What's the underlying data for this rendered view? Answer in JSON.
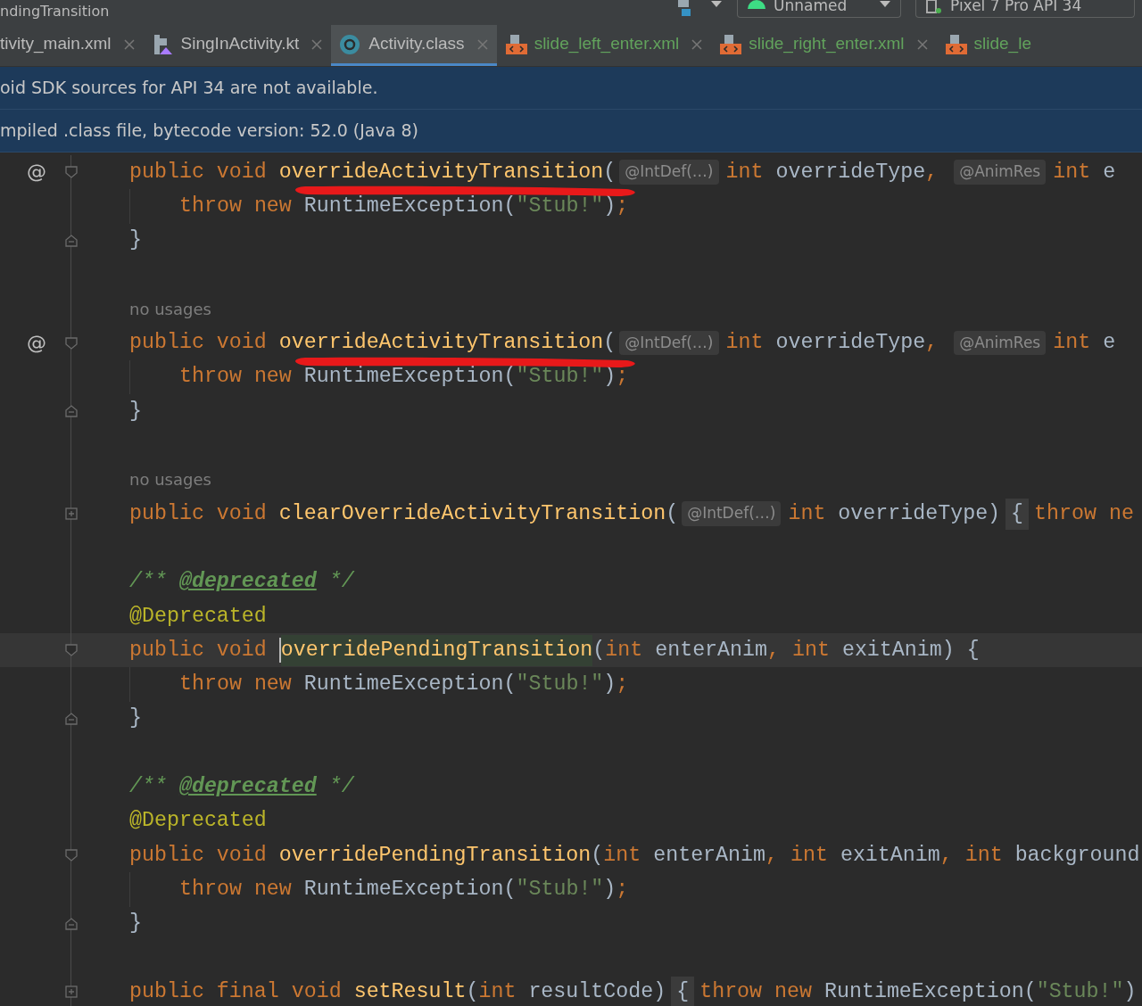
{
  "title_bar": {
    "title": "ndingTransition",
    "run_config": "Unnamed",
    "device": "Pixel 7 Pro API 34"
  },
  "tabs": [
    {
      "label": "tivity_main.xml",
      "color": "#bbbbbb",
      "selected": false,
      "closable": true
    },
    {
      "label": "SingInActivity.kt",
      "kind": "kotlin",
      "color": "#bbbbbb",
      "selected": false,
      "closable": true
    },
    {
      "label": "Activity.class",
      "kind": "class",
      "color": "#bbbbbb",
      "selected": true,
      "closable": true
    },
    {
      "label": "slide_left_enter.xml",
      "kind": "xml",
      "color": "#62a35c",
      "selected": false,
      "closable": true
    },
    {
      "label": "slide_right_enter.xml",
      "kind": "xml",
      "color": "#62a35c",
      "selected": false,
      "closable": true
    },
    {
      "label": "slide_le",
      "kind": "xml",
      "color": "#62a35c",
      "selected": false,
      "closable": false
    }
  ],
  "banners": [
    "oid SDK sources for API 34 are not available.",
    "mpiled .class file, bytecode version: 52.0 (Java 8)"
  ],
  "code_lines": [
    {
      "marker": "@",
      "kind": "fold-start",
      "indented": false,
      "scribble": false,
      "tokens": [
        {
          "kind": "keyword",
          "text": "public void "
        },
        {
          "kind": "function",
          "text": "overrideActivityTransition"
        },
        {
          "kind": "plain",
          "text": "("
        },
        {
          "kind": "hint",
          "text": "@IntDef(…)"
        },
        {
          "kind": "keyword",
          "text": "int "
        },
        {
          "kind": "plain",
          "text": "overrideType"
        },
        {
          "kind": "keyword",
          "text": ", "
        },
        {
          "kind": "hint",
          "text": "@AnimRes"
        },
        {
          "kind": "keyword",
          "text": "int "
        },
        {
          "kind": "plain",
          "text": "e"
        }
      ]
    },
    {
      "kind": "plain",
      "indented": true,
      "scribble": true,
      "tokens": [
        {
          "kind": "keyword",
          "text": "throw new "
        },
        {
          "kind": "plain",
          "text": "RuntimeException("
        },
        {
          "kind": "string",
          "text": "\"Stub!\""
        },
        {
          "kind": "plain",
          "text": ")"
        },
        {
          "kind": "keyword",
          "text": ";"
        }
      ]
    },
    {
      "kind": "fold-end",
      "indented": false,
      "scribble": false,
      "tokens": [
        {
          "kind": "plain",
          "text": "}"
        }
      ]
    },
    {
      "kind": "plain",
      "indented": false,
      "scribble": false
    },
    {
      "kind": "plain",
      "indented": false,
      "scribble": false,
      "tokens": [
        {
          "kind": "usage",
          "text": "no usages"
        }
      ]
    },
    {
      "marker": "@",
      "kind": "fold-start",
      "indented": false,
      "scribble": false,
      "tokens": [
        {
          "kind": "keyword",
          "text": "public void "
        },
        {
          "kind": "function",
          "text": "overrideActivityTransition"
        },
        {
          "kind": "plain",
          "text": "("
        },
        {
          "kind": "hint",
          "text": "@IntDef(…)"
        },
        {
          "kind": "keyword",
          "text": "int "
        },
        {
          "kind": "plain",
          "text": "overrideType"
        },
        {
          "kind": "keyword",
          "text": ", "
        },
        {
          "kind": "hint",
          "text": "@AnimRes"
        },
        {
          "kind": "keyword",
          "text": "int "
        },
        {
          "kind": "plain",
          "text": "e"
        }
      ]
    },
    {
      "kind": "plain",
      "indented": true,
      "scribble": true,
      "tokens": [
        {
          "kind": "keyword",
          "text": "throw new "
        },
        {
          "kind": "plain",
          "text": "RuntimeException("
        },
        {
          "kind": "string",
          "text": "\"Stub!\""
        },
        {
          "kind": "plain",
          "text": ")"
        },
        {
          "kind": "keyword",
          "text": ";"
        }
      ]
    },
    {
      "kind": "fold-end",
      "indented": false,
      "scribble": false,
      "tokens": [
        {
          "kind": "plain",
          "text": "}"
        }
      ]
    },
    {
      "kind": "plain",
      "indented": false,
      "scribble": false
    },
    {
      "kind": "plain",
      "indented": false,
      "scribble": false,
      "tokens": [
        {
          "kind": "usage",
          "text": "no usages"
        }
      ]
    },
    {
      "kind": "collapsed",
      "indented": false,
      "scribble": false,
      "tokens": [
        {
          "kind": "keyword",
          "text": "public void "
        },
        {
          "kind": "function",
          "text": "clearOverrideActivityTransition"
        },
        {
          "kind": "plain",
          "text": "("
        },
        {
          "kind": "hint",
          "text": "@IntDef(…)"
        },
        {
          "kind": "keyword",
          "text": "int "
        },
        {
          "kind": "plain",
          "text": "overrideType)"
        },
        {
          "kind": "folded",
          "text": "{"
        },
        {
          "kind": "keyword",
          "text": "throw ne"
        }
      ]
    },
    {
      "kind": "plain",
      "indented": false,
      "scribble": false
    },
    {
      "kind": "plain",
      "indented": false,
      "scribble": false,
      "tokens": [
        {
          "kind": "comment",
          "text": "/** "
        },
        {
          "kind": "doctag",
          "text": "@deprecated"
        },
        {
          "kind": "comment",
          "text": " */"
        }
      ]
    },
    {
      "kind": "plain",
      "indented": false,
      "scribble": false,
      "tokens": [
        {
          "kind": "annotation",
          "text": "@Deprecated"
        }
      ]
    },
    {
      "kind": "fold-start",
      "indented": false,
      "current": true,
      "scribble": false,
      "tokens": [
        {
          "kind": "keyword",
          "text": "public void "
        },
        {
          "kind": "match",
          "text": "overridePendingTransition",
          "caret": true
        },
        {
          "kind": "plain",
          "text": "("
        },
        {
          "kind": "keyword",
          "text": "int "
        },
        {
          "kind": "plain",
          "text": "enterAnim"
        },
        {
          "kind": "keyword",
          "text": ", "
        },
        {
          "kind": "keyword",
          "text": "int "
        },
        {
          "kind": "plain",
          "text": "exitAnim) {"
        }
      ]
    },
    {
      "kind": "plain",
      "indented": true,
      "scribble": false,
      "tokens": [
        {
          "kind": "keyword",
          "text": "throw new "
        },
        {
          "kind": "plain",
          "text": "RuntimeException("
        },
        {
          "kind": "string",
          "text": "\"Stub!\""
        },
        {
          "kind": "plain",
          "text": ")"
        },
        {
          "kind": "keyword",
          "text": ";"
        }
      ]
    },
    {
      "kind": "fold-end",
      "indented": false,
      "scribble": false,
      "tokens": [
        {
          "kind": "plain",
          "text": "}"
        }
      ]
    },
    {
      "kind": "plain",
      "indented": false,
      "scribble": false
    },
    {
      "kind": "plain",
      "indented": false,
      "scribble": false,
      "tokens": [
        {
          "kind": "comment",
          "text": "/** "
        },
        {
          "kind": "doctag",
          "text": "@deprecated"
        },
        {
          "kind": "comment",
          "text": " */"
        }
      ]
    },
    {
      "kind": "plain",
      "indented": false,
      "scribble": false,
      "tokens": [
        {
          "kind": "annotation",
          "text": "@Deprecated"
        }
      ]
    },
    {
      "kind": "fold-start",
      "indented": false,
      "scribble": false,
      "tokens": [
        {
          "kind": "keyword",
          "text": "public void "
        },
        {
          "kind": "function",
          "text": "overridePendingTransition"
        },
        {
          "kind": "plain",
          "text": "("
        },
        {
          "kind": "keyword",
          "text": "int "
        },
        {
          "kind": "plain",
          "text": "enterAnim"
        },
        {
          "kind": "keyword",
          "text": ", "
        },
        {
          "kind": "keyword",
          "text": "int "
        },
        {
          "kind": "plain",
          "text": "exitAnim"
        },
        {
          "kind": "keyword",
          "text": ", "
        },
        {
          "kind": "keyword",
          "text": "int "
        },
        {
          "kind": "plain",
          "text": "background"
        }
      ]
    },
    {
      "kind": "plain",
      "indented": true,
      "scribble": false,
      "tokens": [
        {
          "kind": "keyword",
          "text": "throw new "
        },
        {
          "kind": "plain",
          "text": "RuntimeException("
        },
        {
          "kind": "string",
          "text": "\"Stub!\""
        },
        {
          "kind": "plain",
          "text": ")"
        },
        {
          "kind": "keyword",
          "text": ";"
        }
      ]
    },
    {
      "kind": "fold-end",
      "indented": false,
      "scribble": false,
      "tokens": [
        {
          "kind": "plain",
          "text": "}"
        }
      ]
    },
    {
      "kind": "plain",
      "indented": false,
      "scribble": false
    },
    {
      "kind": "collapsed",
      "indented": false,
      "scribble": false,
      "tokens": [
        {
          "kind": "keyword",
          "text": "public final void "
        },
        {
          "kind": "function",
          "text": "setResult"
        },
        {
          "kind": "plain",
          "text": "("
        },
        {
          "kind": "keyword",
          "text": "int "
        },
        {
          "kind": "plain",
          "text": "resultCode)"
        },
        {
          "kind": "folded",
          "text": "{"
        },
        {
          "kind": "keyword",
          "text": "throw new "
        },
        {
          "kind": "plain",
          "text": "RuntimeException("
        },
        {
          "kind": "string",
          "text": "\"Stub!\""
        },
        {
          "kind": "plain",
          "text": ")"
        }
      ]
    }
  ]
}
